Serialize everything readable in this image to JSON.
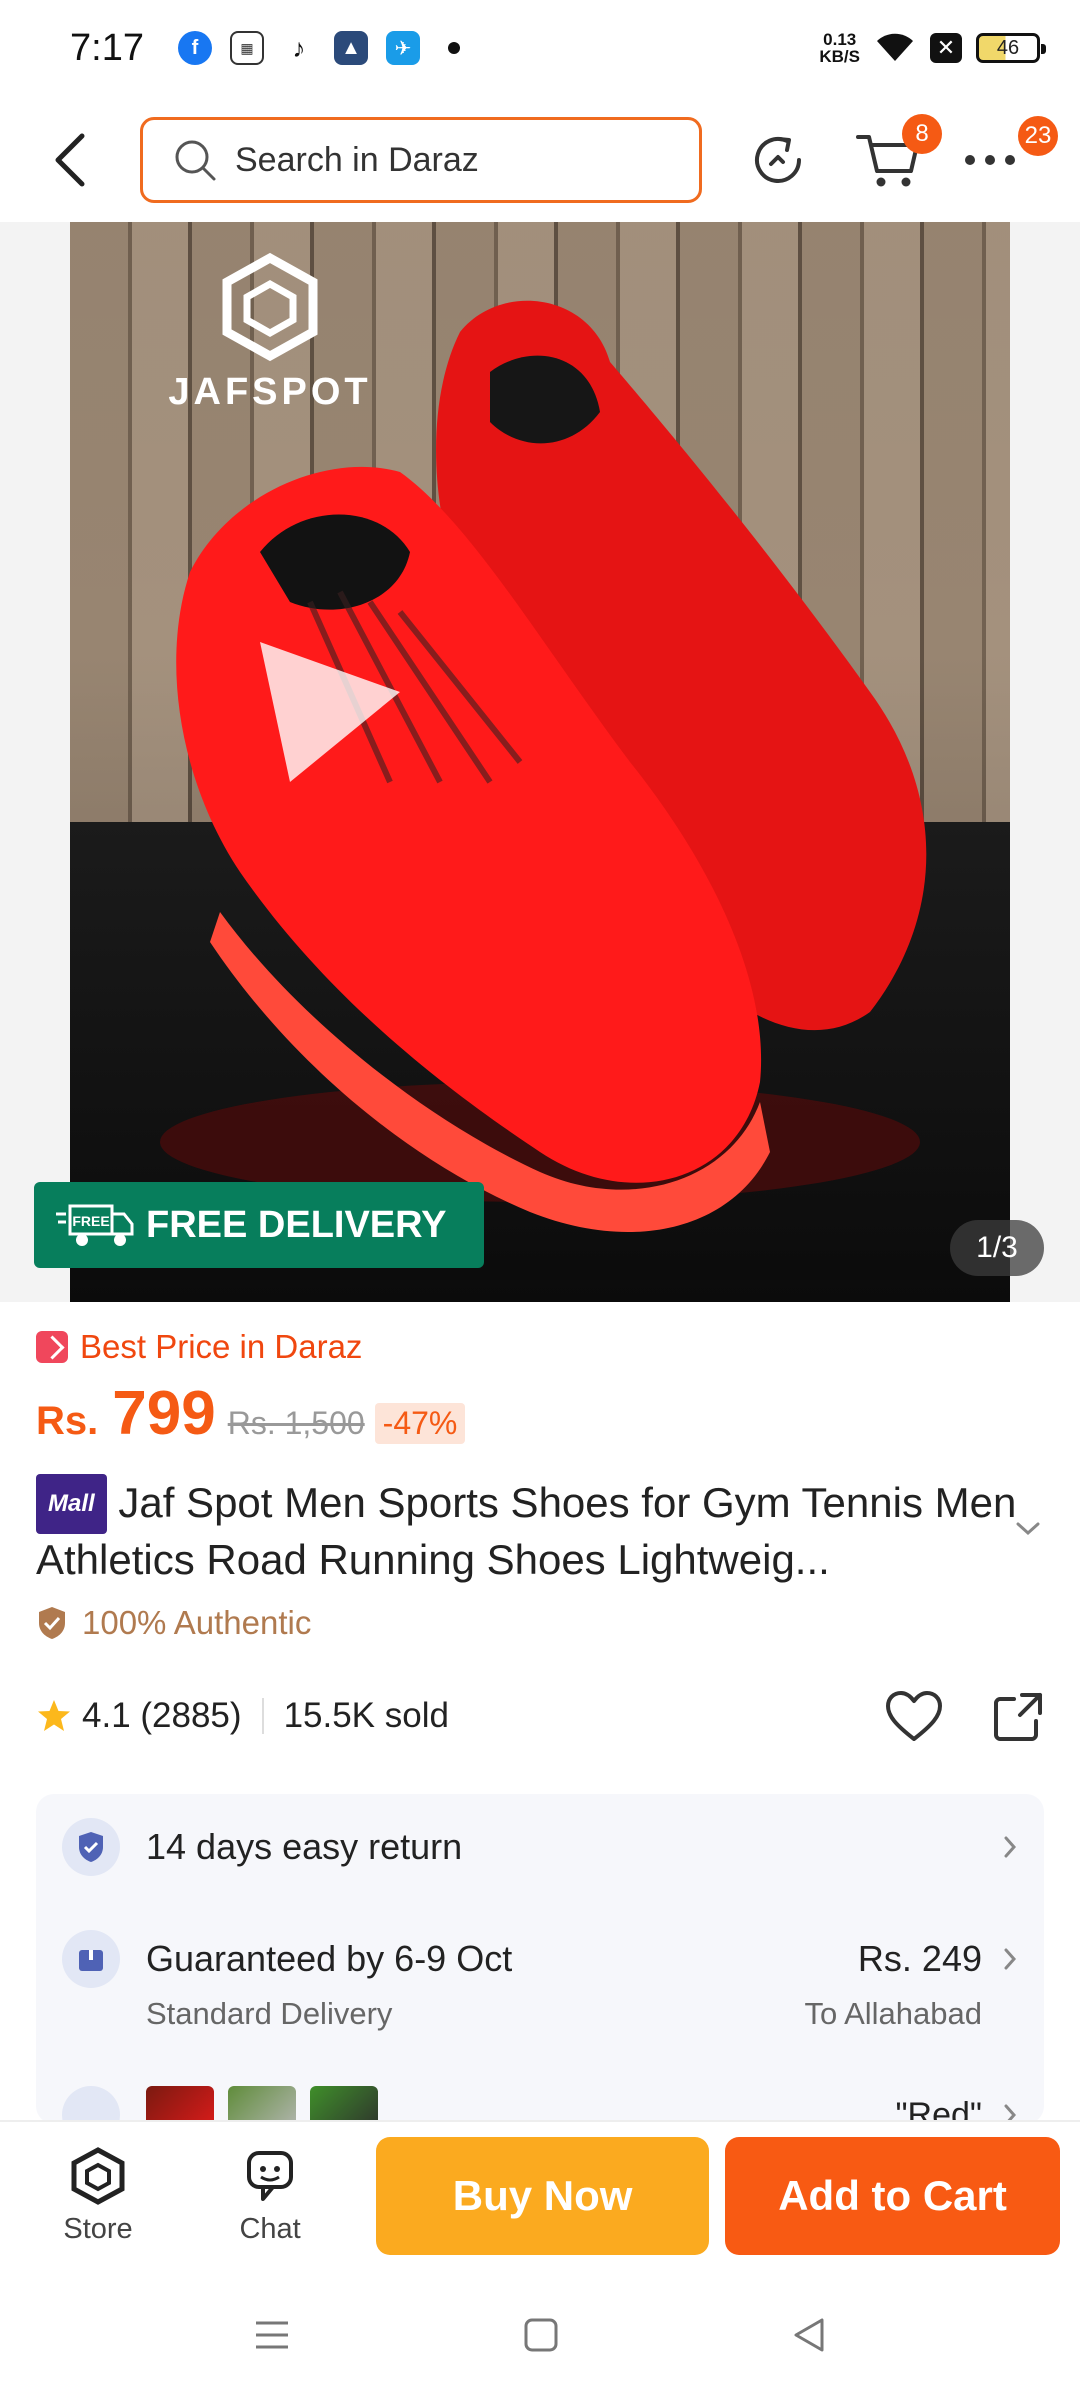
{
  "status_bar": {
    "time": "7:17",
    "speed_value": "0.13",
    "speed_unit": "KB/S",
    "battery": "46",
    "app_icons": [
      "facebook-icon",
      "news-app-icon",
      "tiktok-icon",
      "game-app-icon",
      "messenger-app-icon"
    ]
  },
  "header": {
    "search_placeholder": "Search in Daraz",
    "cart_count": "8",
    "more_count": "23"
  },
  "gallery": {
    "brand": "JAFSPOT",
    "free_delivery_tag": "FREE",
    "free_delivery": "FREE DELIVERY",
    "counter": "1/3"
  },
  "product": {
    "best_price": "Best Price in Daraz",
    "currency": "Rs.",
    "price": "799",
    "original_price": "Rs. 1,500",
    "discount": "-47%",
    "mall_badge": "Mall",
    "title": "Jaf Spot Men Sports Shoes for Gym Tennis Men Athletics Road Running Shoes Lightweig...",
    "authentic": "100% Authentic",
    "rating": "4.1 (2885)",
    "sold": "15.5K sold"
  },
  "services": {
    "return": "14 days easy return",
    "delivery_title": "Guaranteed by 6-9 Oct",
    "delivery_type": "Standard Delivery",
    "delivery_price": "Rs. 249",
    "delivery_destination": "To Allahabad",
    "variant_label": "\"Red\""
  },
  "bottom_bar": {
    "store": "Store",
    "chat": "Chat",
    "buy_now": "Buy Now",
    "add_to_cart": "Add to Cart"
  },
  "colors": {
    "accent": "#f55a14",
    "buy_now": "#fbaa1f",
    "add_to_cart": "#f85a13",
    "free_delivery": "#077e5c",
    "mall": "#3f2487"
  }
}
